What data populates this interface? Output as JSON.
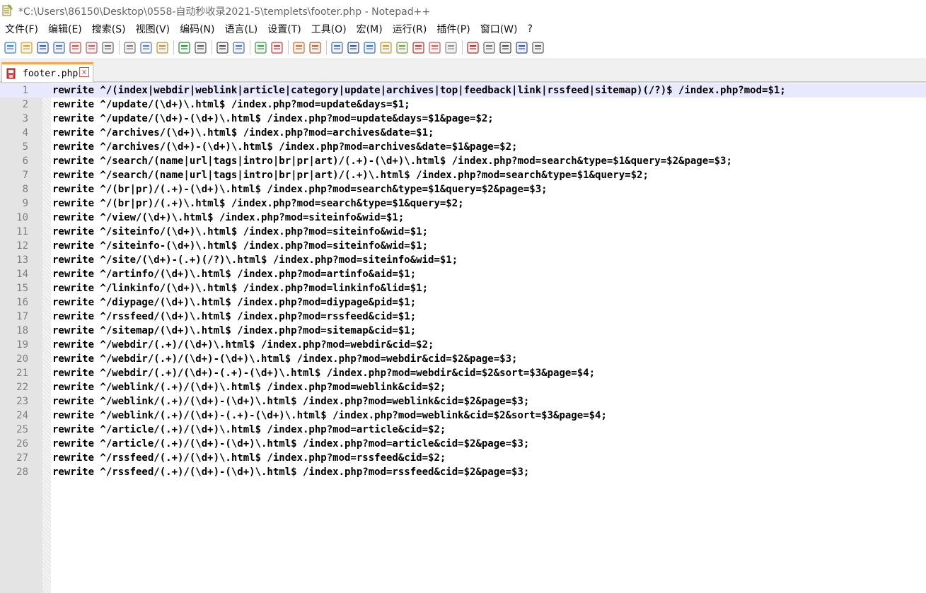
{
  "window": {
    "title": "*C:\\Users\\86150\\Desktop\\0558-自动秒收录2021-5\\templets\\footer.php - Notepad++"
  },
  "menu": {
    "items": [
      "文件(F)",
      "编辑(E)",
      "搜索(S)",
      "视图(V)",
      "编码(N)",
      "语言(L)",
      "设置(T)",
      "工具(O)",
      "宏(M)",
      "运行(R)",
      "插件(P)",
      "窗口(W)",
      "?"
    ]
  },
  "toolbar": {
    "icons": [
      "new-file-icon",
      "open-file-icon",
      "save-icon",
      "save-all-icon",
      "close-icon",
      "close-all-icon",
      "print-icon",
      "cut-icon",
      "copy-icon",
      "paste-icon",
      "undo-icon",
      "redo-icon",
      "find-icon",
      "replace-icon",
      "zoom-in-icon",
      "zoom-out-icon",
      "sync-vertical-icon",
      "sync-horizontal-icon",
      "word-wrap-icon",
      "show-all-chars-icon",
      "indent-guide-icon",
      "lang-udl-icon",
      "doc-map-icon",
      "function-list-icon",
      "folder-as-workspace-icon",
      "monitoring-icon",
      "record-macro-icon",
      "stop-record-icon",
      "play-macro-icon",
      "run-macro-multiple-icon",
      "save-macro-icon"
    ]
  },
  "tab": {
    "label": "footer.php",
    "close": "x"
  },
  "editor": {
    "current_line": 1,
    "lines": [
      "rewrite ^/(index|webdir|weblink|article|category|update|archives|top|feedback|link|rssfeed|sitemap)(/?)$ /index.php?mod=$1;",
      "rewrite ^/update/(\\d+)\\.html$ /index.php?mod=update&days=$1;",
      "rewrite ^/update/(\\d+)-(\\d+)\\.html$ /index.php?mod=update&days=$1&page=$2;",
      "rewrite ^/archives/(\\d+)\\.html$ /index.php?mod=archives&date=$1;",
      "rewrite ^/archives/(\\d+)-(\\d+)\\.html$ /index.php?mod=archives&date=$1&page=$2;",
      "rewrite ^/search/(name|url|tags|intro|br|pr|art)/(.+)-(\\d+)\\.html$ /index.php?mod=search&type=$1&query=$2&page=$3;",
      "rewrite ^/search/(name|url|tags|intro|br|pr|art)/(.+)\\.html$ /index.php?mod=search&type=$1&query=$2;",
      "rewrite ^/(br|pr)/(.+)-(\\d+)\\.html$ /index.php?mod=search&type=$1&query=$2&page=$3;",
      "rewrite ^/(br|pr)/(.+)\\.html$ /index.php?mod=search&type=$1&query=$2;",
      "rewrite ^/view/(\\d+)\\.html$ /index.php?mod=siteinfo&wid=$1;",
      "rewrite ^/siteinfo/(\\d+)\\.html$ /index.php?mod=siteinfo&wid=$1;",
      "rewrite ^/siteinfo-(\\d+)\\.html$ /index.php?mod=siteinfo&wid=$1;",
      "rewrite ^/site/(\\d+)-(.+)(/?)\\.html$ /index.php?mod=siteinfo&wid=$1;",
      "rewrite ^/artinfo/(\\d+)\\.html$ /index.php?mod=artinfo&aid=$1;",
      "rewrite ^/linkinfo/(\\d+)\\.html$ /index.php?mod=linkinfo&lid=$1;",
      "rewrite ^/diypage/(\\d+)\\.html$ /index.php?mod=diypage&pid=$1;",
      "rewrite ^/rssfeed/(\\d+)\\.html$ /index.php?mod=rssfeed&cid=$1;",
      "rewrite ^/sitemap/(\\d+)\\.html$ /index.php?mod=sitemap&cid=$1;",
      "rewrite ^/webdir/(.+)/(\\d+)\\.html$ /index.php?mod=webdir&cid=$2;",
      "rewrite ^/webdir/(.+)/(\\d+)-(\\d+)\\.html$ /index.php?mod=webdir&cid=$2&page=$3;",
      "rewrite ^/webdir/(.+)/(\\d+)-(.+)-(\\d+)\\.html$ /index.php?mod=webdir&cid=$2&sort=$3&page=$4;",
      "rewrite ^/weblink/(.+)/(\\d+)\\.html$ /index.php?mod=weblink&cid=$2;",
      "rewrite ^/weblink/(.+)/(\\d+)-(\\d+)\\.html$ /index.php?mod=weblink&cid=$2&page=$3;",
      "rewrite ^/weblink/(.+)/(\\d+)-(.+)-(\\d+)\\.html$ /index.php?mod=weblink&cid=$2&sort=$3&page=$4;",
      "rewrite ^/article/(.+)/(\\d+)\\.html$ /index.php?mod=article&cid=$2;",
      "rewrite ^/article/(.+)/(\\d+)-(\\d+)\\.html$ /index.php?mod=article&cid=$2&page=$3;",
      "rewrite ^/rssfeed/(.+)/(\\d+)\\.html$ /index.php?mod=rssfeed&cid=$2;",
      "rewrite ^/rssfeed/(.+)/(\\d+)-(\\d+)\\.html$ /index.php?mod=rssfeed&cid=$2&page=$3;"
    ]
  }
}
